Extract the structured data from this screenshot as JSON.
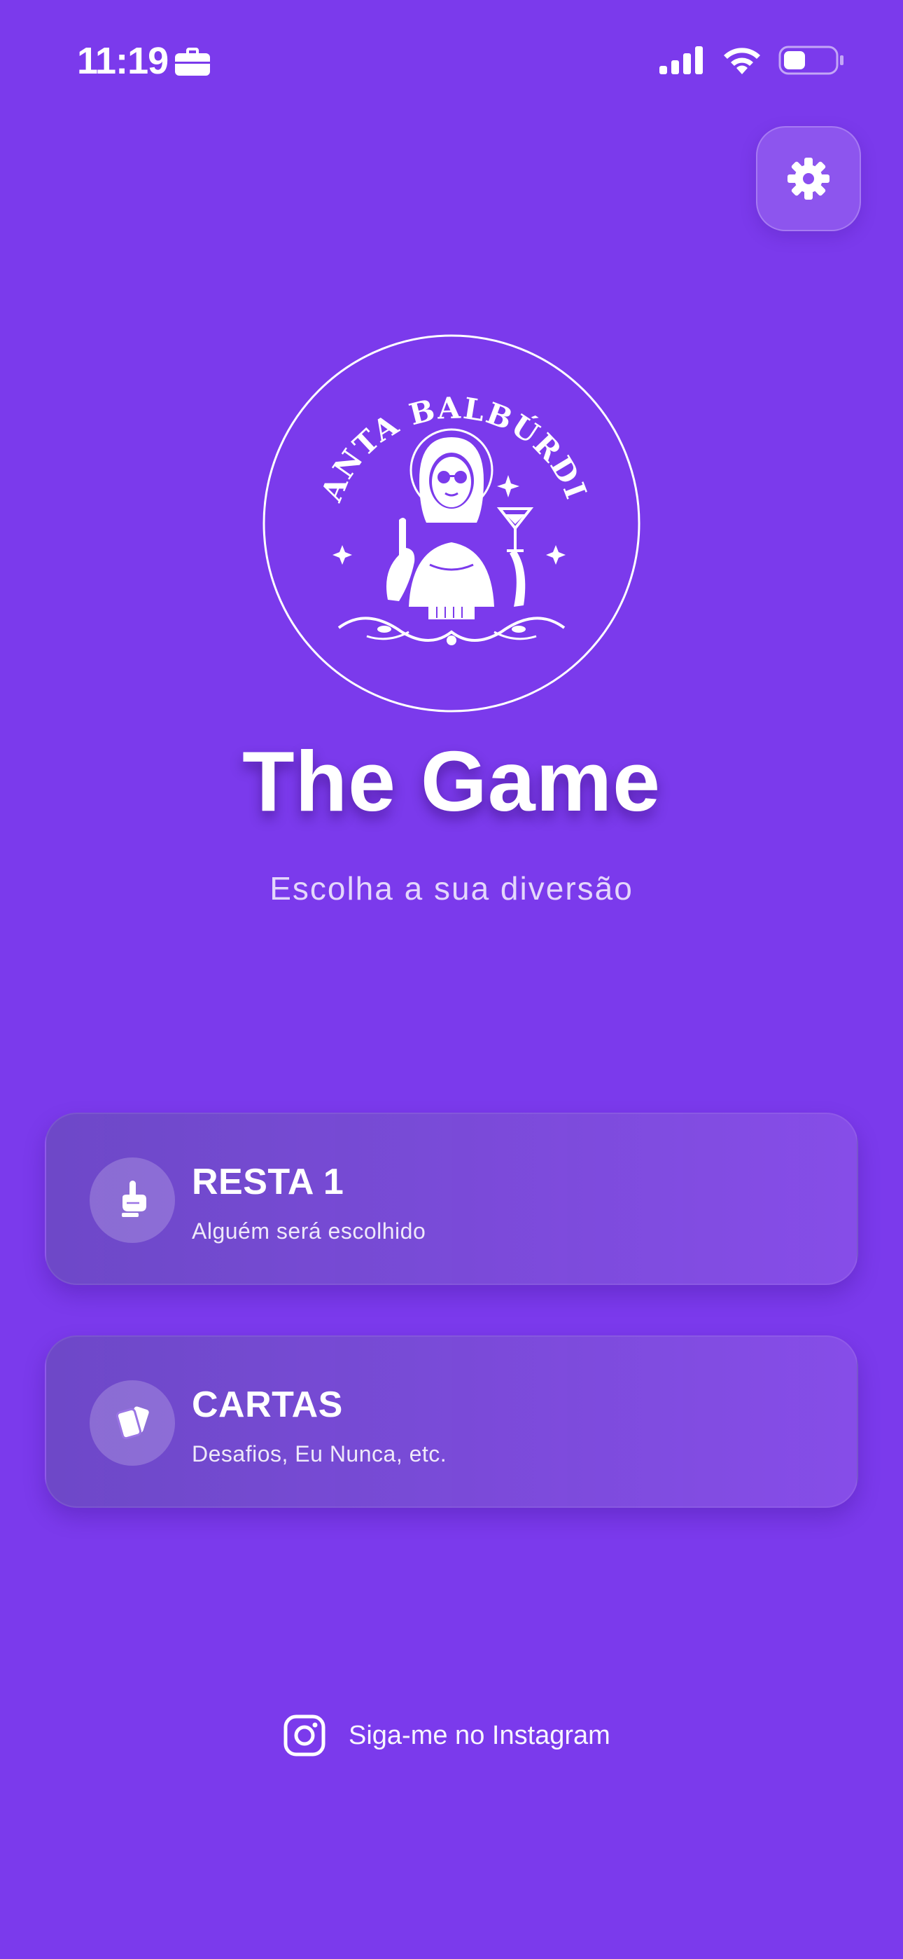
{
  "status_bar": {
    "time": "11:19",
    "work_icon": "briefcase-icon",
    "signal_icon": "cellular-signal-icon",
    "wifi_icon": "wifi-icon",
    "battery_icon": "battery-icon",
    "battery_level": 0.35
  },
  "settings": {
    "icon": "gear-icon"
  },
  "logo": {
    "brand_text": "SANTA BALBÚRDIA",
    "icon": "santa-balburdia-logo"
  },
  "header": {
    "title": "The Game",
    "subtitle": "Escolha a sua diversão"
  },
  "modes": [
    {
      "title": "RESTA 1",
      "subtitle": "Alguém será escolhido",
      "icon": "pointing-hand-icon"
    },
    {
      "title": "CARTAS",
      "subtitle": "Desafios, Eu Nunca, etc.",
      "icon": "cards-icon"
    }
  ],
  "footer": {
    "instagram_label": "Siga-me no Instagram",
    "instagram_icon": "instagram-icon"
  },
  "colors": {
    "background": "#7b3aec",
    "card_gradient_start": "#6c4ac4",
    "card_gradient_end": "#874ee8",
    "text": "#ffffff"
  }
}
